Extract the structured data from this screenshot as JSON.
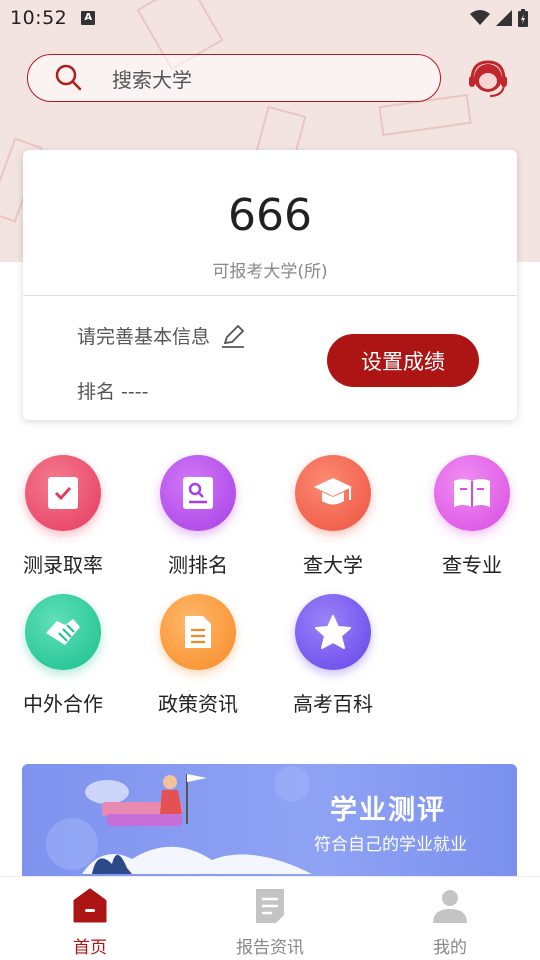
{
  "status_bar": {
    "time": "10:52",
    "badge": "A"
  },
  "search": {
    "placeholder": "搜索大学"
  },
  "summary_card": {
    "count": "666",
    "count_label": "可报考大学(所)",
    "info_prompt": "请完善基本信息",
    "rank_label": "排名 ----",
    "set_score_button": "设置成绩"
  },
  "features": [
    {
      "label": "测录取率",
      "icon": "check-document-icon",
      "color": "#ef4f6e"
    },
    {
      "label": "测排名",
      "icon": "search-document-icon",
      "color": "#b94ff0"
    },
    {
      "label": "查大学",
      "icon": "graduation-cap-icon",
      "color": "#f66f5a"
    },
    {
      "label": "查专业",
      "icon": "open-book-icon",
      "color": "#e863ed"
    },
    {
      "label": "中外合作",
      "icon": "handshake-icon",
      "color": "#2fcfa2"
    },
    {
      "label": "政策资讯",
      "icon": "document-icon",
      "color": "#fb9a3c"
    },
    {
      "label": "高考百科",
      "icon": "star-icon",
      "color": "#7a5af2"
    }
  ],
  "banner": {
    "title": "学业测评",
    "subtitle": "符合自己的学业就业"
  },
  "tabbar": {
    "items": [
      {
        "label": "首页",
        "active": true
      },
      {
        "label": "报告资讯",
        "active": false
      },
      {
        "label": "我的",
        "active": false
      }
    ],
    "active_color": "#ad1515"
  }
}
